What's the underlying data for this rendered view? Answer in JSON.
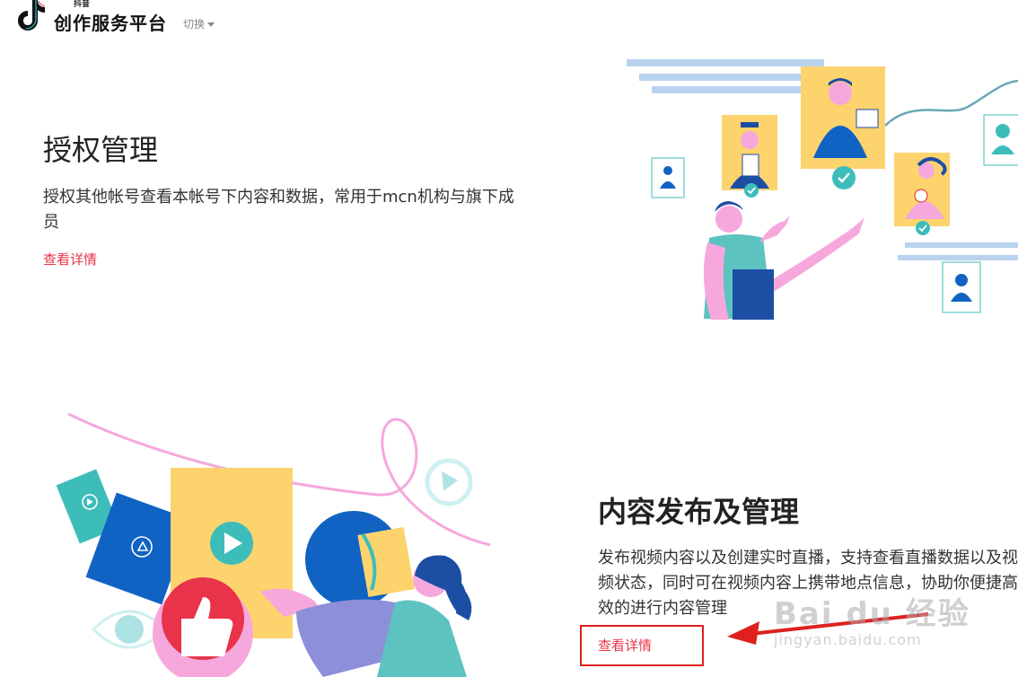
{
  "header": {
    "brand_small": "抖音",
    "brand": "创作服务平台",
    "switch_label": "切换"
  },
  "section_authorization": {
    "title": "授权管理",
    "description": "授权其他帐号查看本帐号下内容和数据，常用于mcn机构与旗下成员",
    "link": "查看详情"
  },
  "section_content": {
    "title": "内容发布及管理",
    "description": "发布视频内容以及创建实时直播，支持查看直播数据以及视频状态，同时可在视频内容上携带地点信息，协助你便捷高效的进行内容管理",
    "link": "查看详情"
  },
  "watermark": {
    "main": "Bai du 经验",
    "sub": "jingyan.baidu.com"
  },
  "colors": {
    "accent_link": "#e8334a",
    "highlight_box": "#e0201f",
    "illustration_yellow": "#fdd36e",
    "illustration_blue": "#0f6fc6",
    "illustration_teal": "#3dbdba",
    "illustration_pink": "#f6a8dc"
  },
  "icons": [
    "douyin-logo-icon",
    "caret-down-icon",
    "person-icon",
    "check-icon",
    "play-icon",
    "thumbs-up-icon",
    "eye-icon",
    "arrow-icon"
  ]
}
